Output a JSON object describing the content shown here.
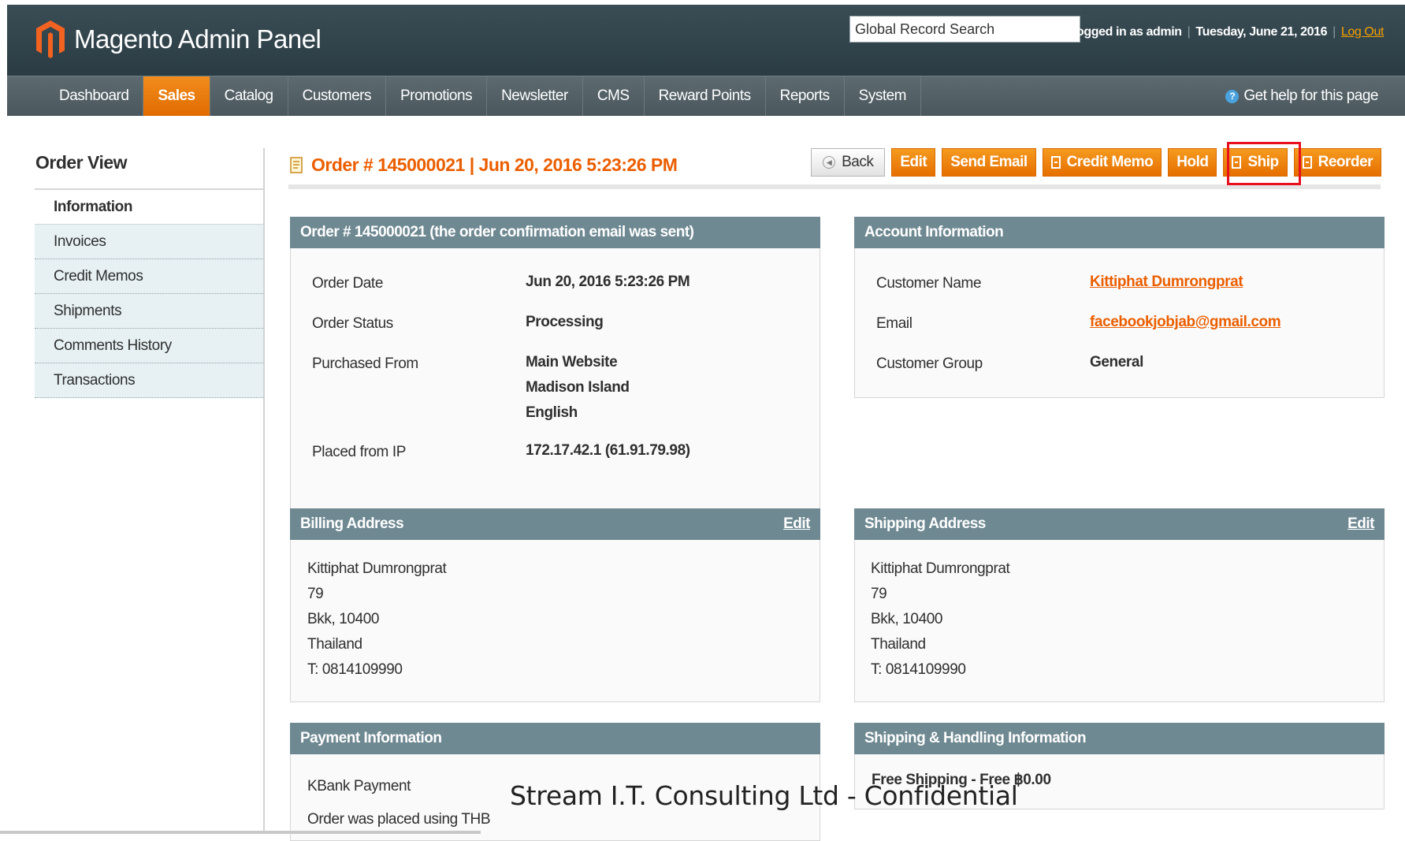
{
  "header": {
    "app_name": "Magento Admin Panel",
    "search_placeholder": "Global Record Search",
    "logged_in": "Logged in as admin",
    "date": "Tuesday, June 21, 2016",
    "logout": "Log Out"
  },
  "nav": {
    "items": [
      "Dashboard",
      "Sales",
      "Catalog",
      "Customers",
      "Promotions",
      "Newsletter",
      "CMS",
      "Reward Points",
      "Reports",
      "System"
    ],
    "active": "Sales",
    "help": "Get help for this page"
  },
  "sidebar": {
    "title": "Order View",
    "tabs": [
      "Information",
      "Invoices",
      "Credit Memos",
      "Shipments",
      "Comments History",
      "Transactions"
    ],
    "active": "Information"
  },
  "page": {
    "title": "Order # 145000021 | Jun 20, 2016 5:23:26 PM",
    "buttons": {
      "back": "Back",
      "edit": "Edit",
      "send_email": "Send Email",
      "credit_memo": "Credit Memo",
      "hold": "Hold",
      "ship": "Ship",
      "reorder": "Reorder"
    }
  },
  "order_box": {
    "title": "Order # 145000021 (the order confirmation email was sent)",
    "order_date_label": "Order Date",
    "order_date": "Jun 20, 2016 5:23:26 PM",
    "status_label": "Order Status",
    "status": "Processing",
    "purchased_from_label": "Purchased From",
    "purchased_from": [
      "Main Website",
      "Madison Island",
      "English"
    ],
    "ip_label": "Placed from IP",
    "ip": "172.17.42.1 (61.91.79.98)"
  },
  "account_box": {
    "title": "Account Information",
    "name_label": "Customer Name",
    "name": "Kittiphat Dumrongprat",
    "email_label": "Email",
    "email": "facebookjobjab@gmail.com",
    "group_label": "Customer Group",
    "group": "General"
  },
  "billing_box": {
    "title": "Billing Address",
    "edit": "Edit",
    "lines": [
      "Kittiphat Dumrongprat",
      "79",
      "Bkk, 10400",
      "Thailand",
      "T: 0814109990"
    ]
  },
  "shipping_box": {
    "title": "Shipping Address",
    "edit": "Edit",
    "lines": [
      "Kittiphat Dumrongprat",
      "79",
      "Bkk, 10400",
      "Thailand",
      "T: 0814109990"
    ]
  },
  "payment_box": {
    "title": "Payment Information",
    "method": "KBank Payment",
    "currency_note": "Order was placed using THB"
  },
  "shipping_method_box": {
    "title": "Shipping & Handling Information",
    "method": "Free Shipping - Free ฿0.00"
  },
  "watermark": "Stream I.T. Consulting Ltd - Confidential",
  "colors": {
    "header_bg": "#2f4149",
    "nav_bg": "#535f65",
    "accent_orange": "#eb5e00",
    "box_head": "#6f8992",
    "highlight_red": "#e8101f"
  }
}
